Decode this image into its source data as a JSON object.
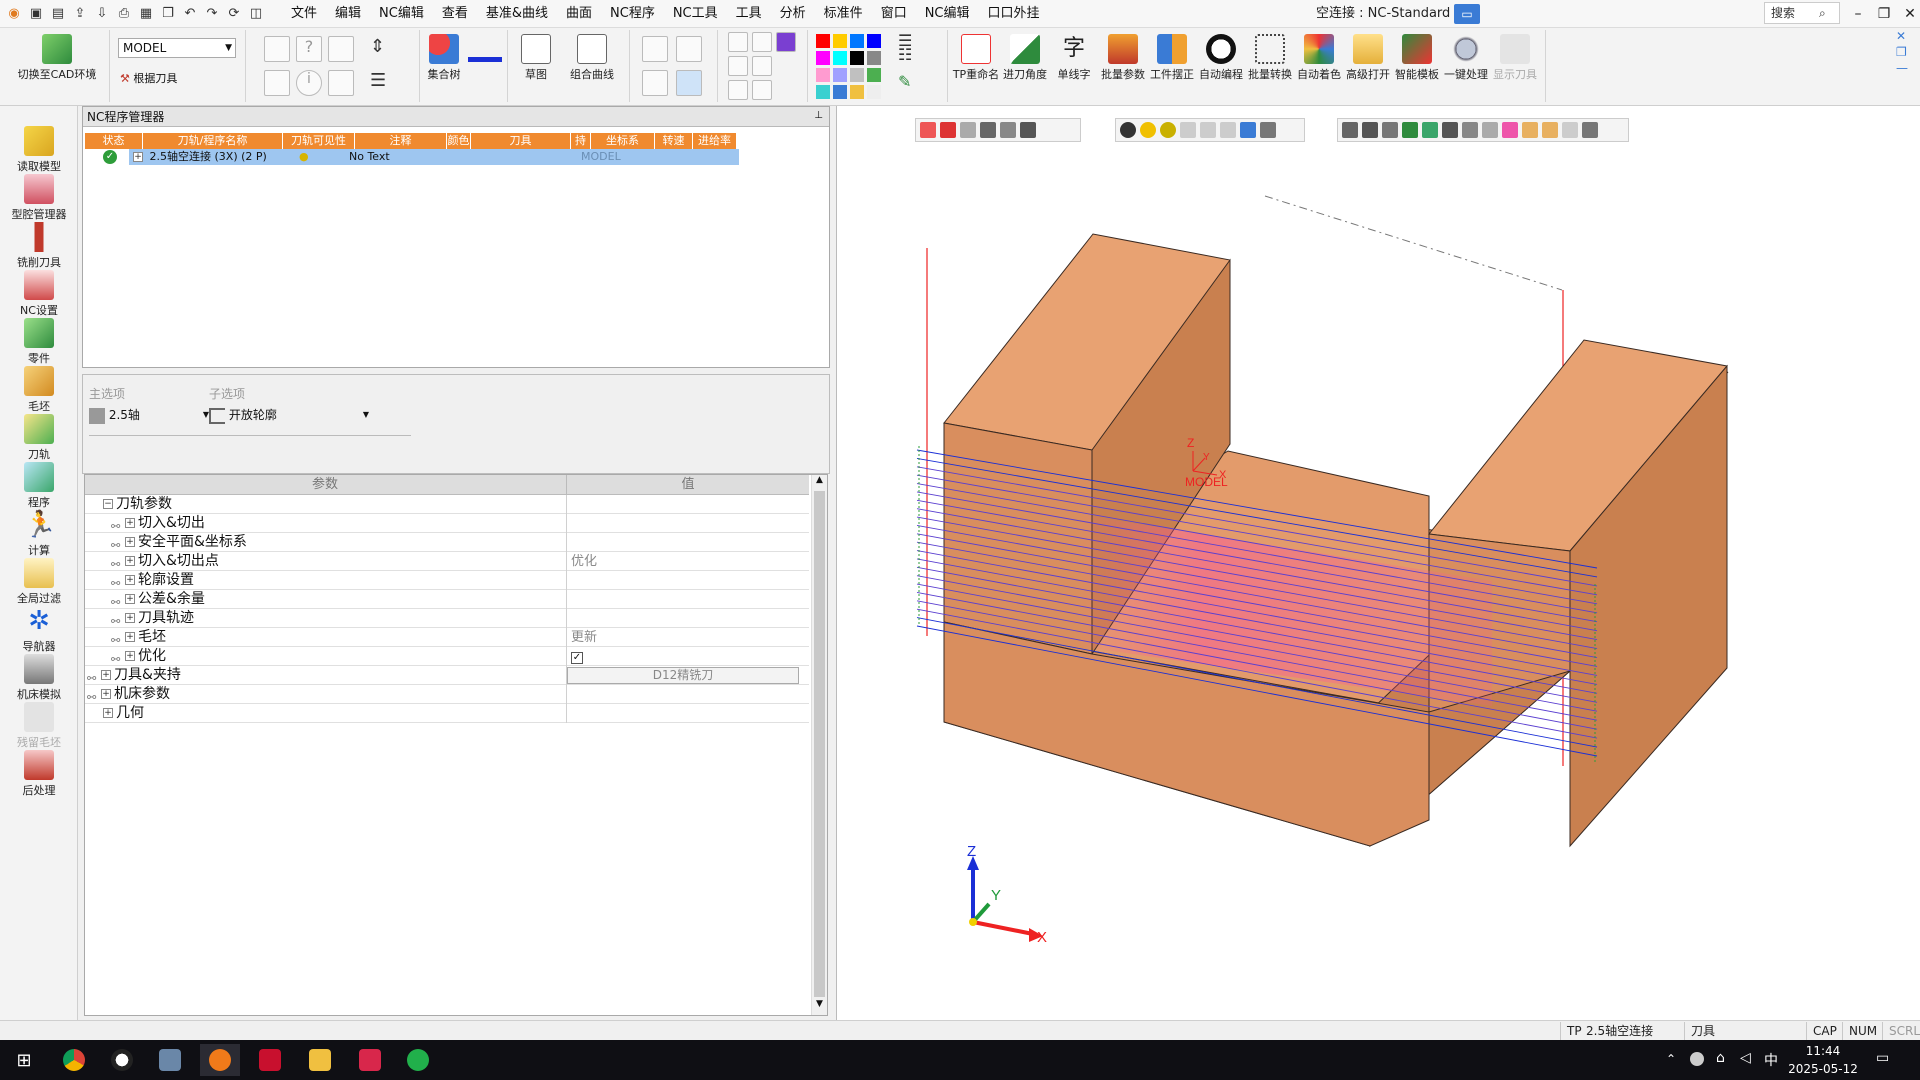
{
  "menu": [
    "文件",
    "编辑",
    "NC编辑",
    "查看",
    "基准&曲线",
    "曲面",
    "NC程序",
    "NC工具",
    "工具",
    "分析",
    "标准件",
    "窗口",
    "NC编辑",
    "口口外挂"
  ],
  "title": {
    "connection": "空连接 : NC-Standard",
    "search_label": "搜索",
    "search_icon": "search-icon"
  },
  "ribbon": {
    "switch_cad": "切换至CAD环境",
    "model_select": "MODEL",
    "by_tool": "根据刀具",
    "assembly_tree": "集合树",
    "sketch": "草图",
    "combo_curve": "组合曲线",
    "tools": [
      "TP重命名",
      "进刀角度",
      "单线字",
      "批量参数",
      "工件摆正",
      "自动编程",
      "批量转换",
      "自动着色",
      "高级打开",
      "智能模板",
      "一键处理",
      "显示刀具"
    ]
  },
  "left_toolbar": [
    "读取模型",
    "型腔管理器",
    "铣削刀具",
    "NC设置",
    "零件",
    "毛坯",
    "刀轨",
    "程序",
    "计算",
    "全局过滤",
    "导航器",
    "机床模拟",
    "残留毛坯",
    "后处理"
  ],
  "nc_manager": {
    "title": "NC程序管理器",
    "columns": [
      "状态",
      "刀轨/程序名称",
      "刀轨可见性",
      "注释",
      "颜色",
      "刀具",
      "持",
      "坐标系",
      "转速",
      "进给率"
    ],
    "row": {
      "name": "2.5轴空连接 (3X) (2 P)",
      "note": "No Text",
      "coord": "MODEL"
    }
  },
  "options": {
    "main_label": "主选项",
    "main_value": "2.5轴",
    "sub_label": "子选项",
    "sub_value": "开放轮廓"
  },
  "params": {
    "col_param": "参数",
    "col_value": "值",
    "rows": [
      {
        "name": "刀轨参数",
        "value": ""
      },
      {
        "name": "切入&切出",
        "value": ""
      },
      {
        "name": "安全平面&坐标系",
        "value": ""
      },
      {
        "name": "切入&切出点",
        "value": "优化"
      },
      {
        "name": "轮廓设置",
        "value": ""
      },
      {
        "name": "公差&余量",
        "value": ""
      },
      {
        "name": "刀具轨迹",
        "value": ""
      },
      {
        "name": "毛坯",
        "value": "更新"
      },
      {
        "name": "优化",
        "value": "✓"
      },
      {
        "name": "刀具&夹持",
        "value": "D12精铣刀"
      },
      {
        "name": "机床参数",
        "value": ""
      },
      {
        "name": "几何",
        "value": ""
      }
    ]
  },
  "viewport": {
    "model_label": "MODEL",
    "axis_x": "X",
    "axis_y": "Y",
    "axis_z": "Z",
    "mini_z": "Z",
    "mini_y": "Y",
    "mini_x": "X"
  },
  "status": {
    "tp": "TP",
    "tp_name": "2.5轴空连接",
    "tool": "刀具",
    "caps": "CAP",
    "num": "NUM",
    "scrl": "SCRL"
  },
  "taskbar": {
    "time": "11:44",
    "date": "2025-05-12",
    "ime": "中"
  },
  "colors": {
    "block": "#d99060",
    "block_top": "#e8a272",
    "block_side": "#c57f52",
    "toolpath_blue": "#1a2fd6",
    "toolpath_pink": "#ff4fa0",
    "accent": "#f08a2f"
  }
}
